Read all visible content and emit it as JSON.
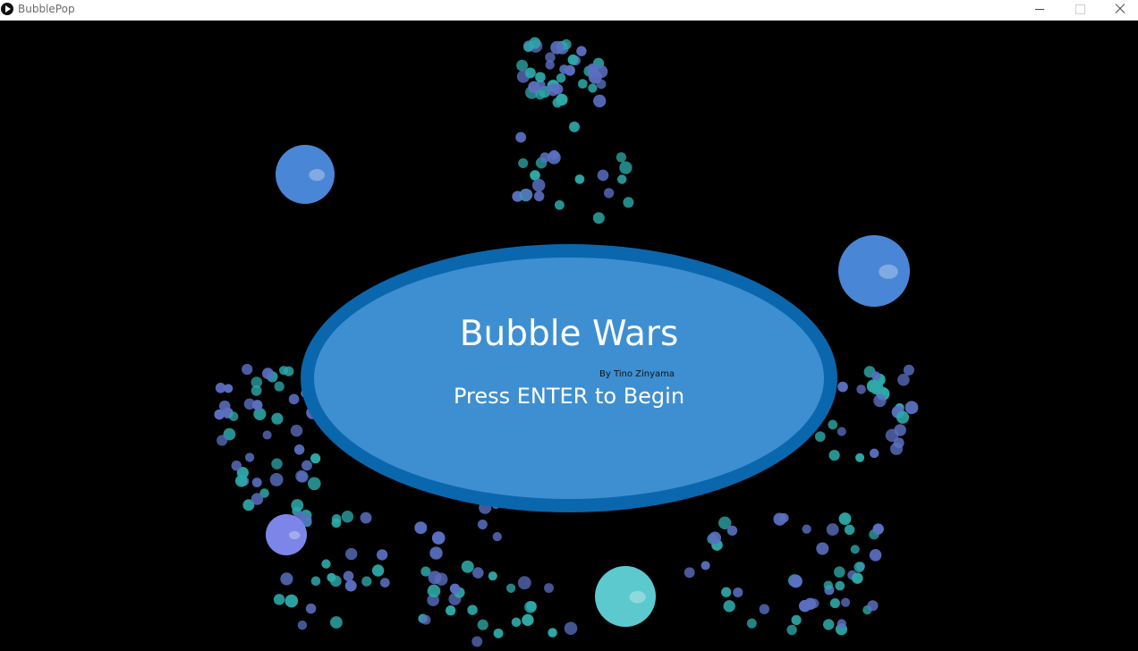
{
  "window": {
    "title": "BubblePop"
  },
  "menu": {
    "title": "Bubble Wars",
    "credit": "By Tino Zinyama",
    "prompt": "Press ENTER to Begin"
  },
  "colors": {
    "background": "#000000",
    "menu_border": "#0b67ad",
    "menu_fill": "#3e8fd2",
    "particle_teal": "#2ea8a8",
    "particle_blue": "#5a6fc0",
    "bubble_blue": "#4a86d6",
    "bubble_violet": "#7d86e8",
    "bubble_cyan": "#5cc9cf"
  },
  "icons": [
    "app-icon",
    "minimize-icon",
    "maximize-icon",
    "close-icon"
  ]
}
